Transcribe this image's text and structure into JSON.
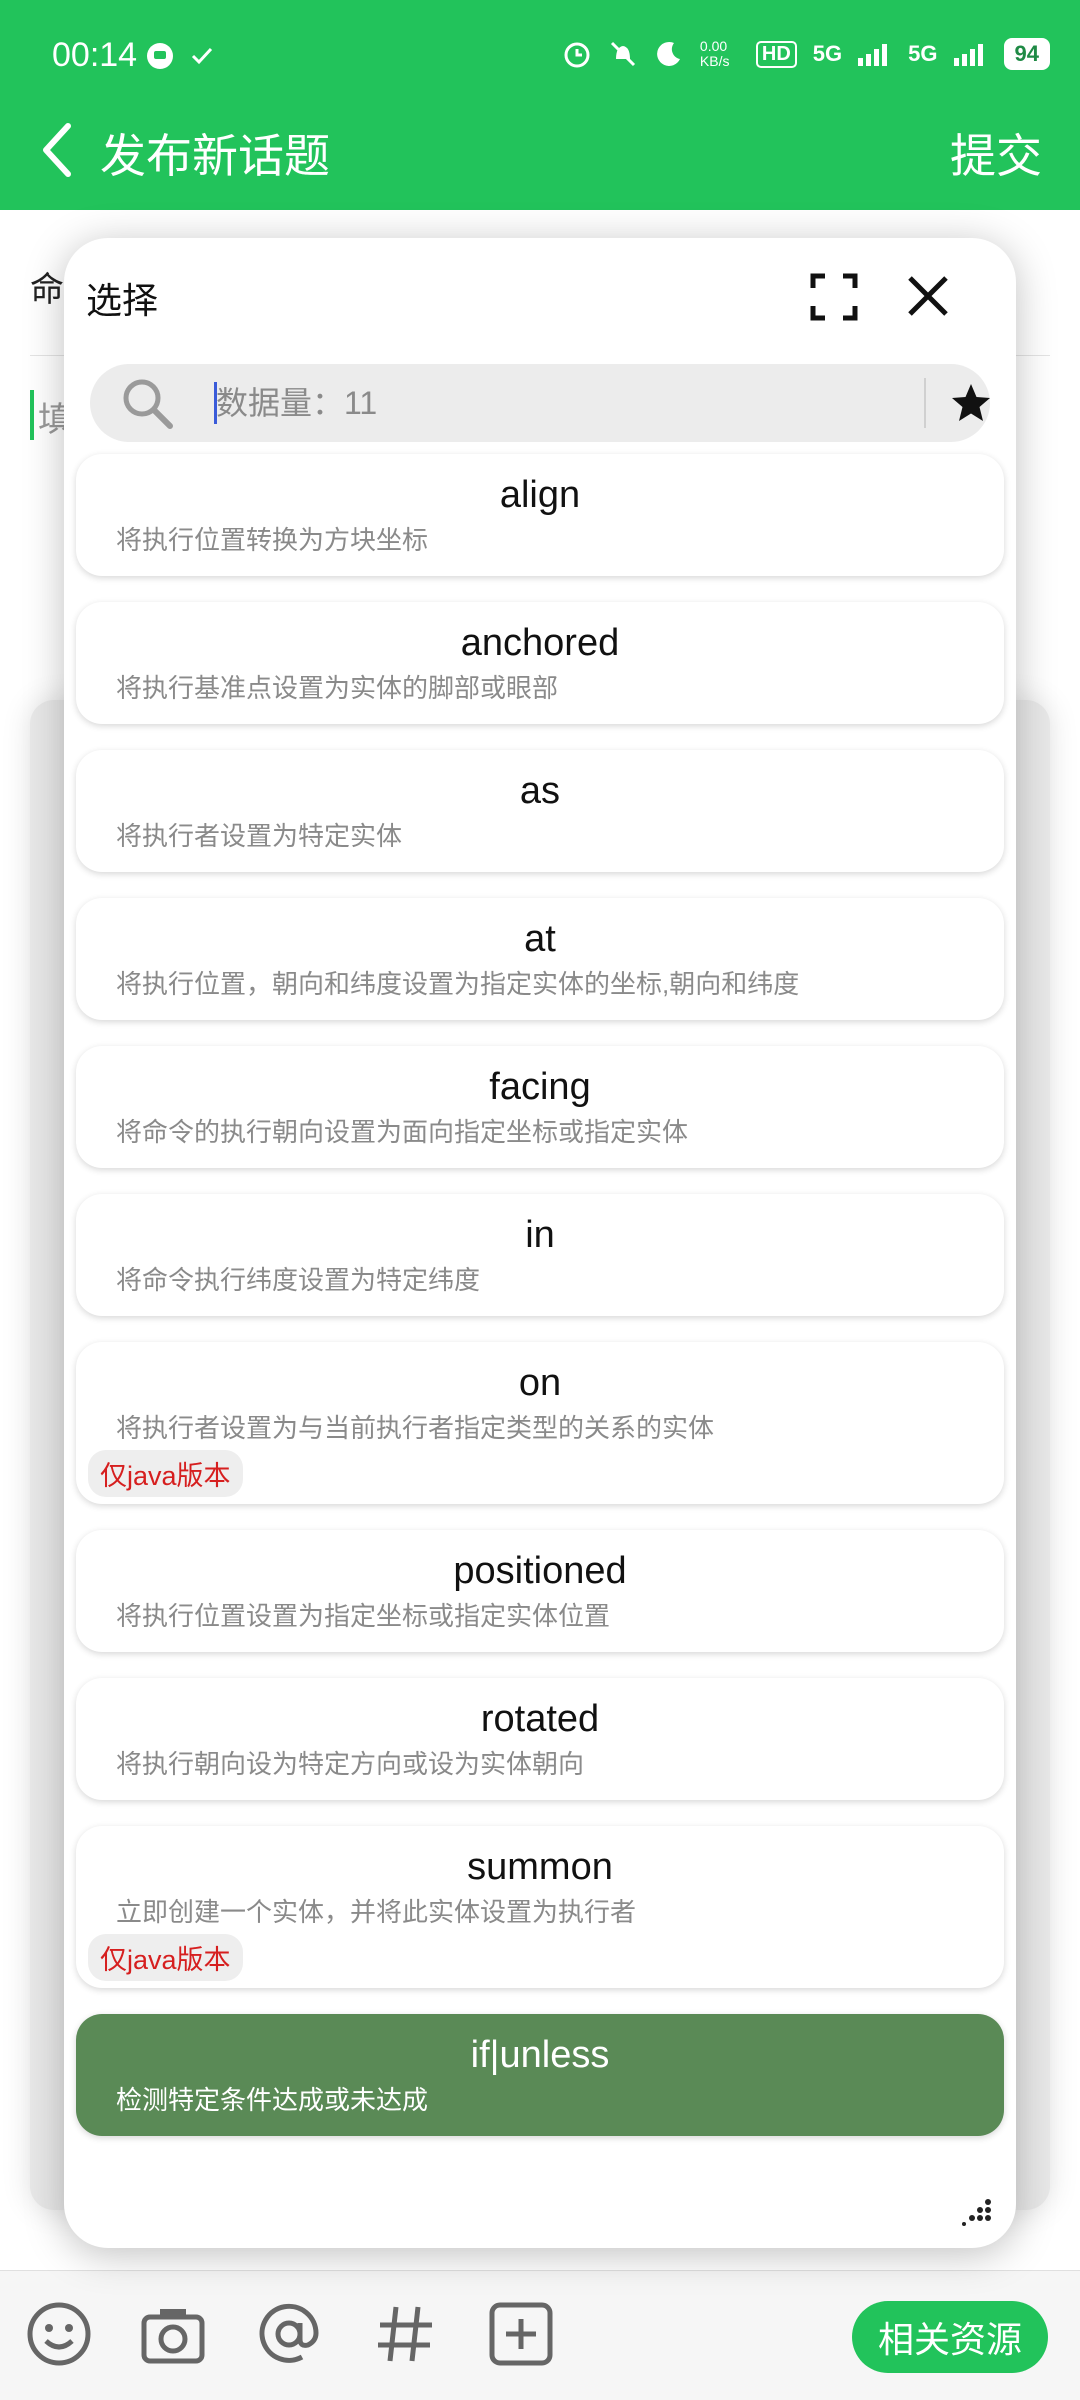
{
  "status_bar": {
    "time": "00:14",
    "net_speed": "0.00 KB/s",
    "hd": "HD",
    "signal_1": "5G",
    "signal_2": "5G",
    "battery": "94"
  },
  "header": {
    "title": "发布新话题",
    "submit_label": "提交"
  },
  "background_form": {
    "line1": "命",
    "line2": "填"
  },
  "dialog": {
    "title": "选择",
    "search_placeholder": "数据量：11",
    "items": [
      {
        "name": "align",
        "desc": "将执行位置转换为方块坐标",
        "badge": ""
      },
      {
        "name": "anchored",
        "desc": "将执行基准点设置为实体的脚部或眼部",
        "badge": ""
      },
      {
        "name": "as",
        "desc": "将执行者设置为特定实体",
        "badge": ""
      },
      {
        "name": "at",
        "desc": "将执行位置，朝向和纬度设置为指定实体的坐标,朝向和纬度",
        "badge": ""
      },
      {
        "name": "facing",
        "desc": "将命令的执行朝向设置为面向指定坐标或指定实体",
        "badge": ""
      },
      {
        "name": "in",
        "desc": "将命令执行纬度设置为特定纬度",
        "badge": ""
      },
      {
        "name": "on",
        "desc": "将执行者设置为与当前执行者指定类型的关系的实体",
        "badge": "仅java版本"
      },
      {
        "name": "positioned",
        "desc": "将执行位置设置为指定坐标或指定实体位置",
        "badge": ""
      },
      {
        "name": "rotated",
        "desc": "将执行朝向设为特定方向或设为实体朝向",
        "badge": ""
      },
      {
        "name": "summon",
        "desc": "立即创建一个实体，并将此实体设置为执行者",
        "badge": "仅java版本"
      },
      {
        "name": "if|unless",
        "desc": "检测特定条件达成或未达成",
        "badge": "",
        "selected": true
      }
    ]
  },
  "bottom_toolbar": {
    "icons": [
      "emoji-icon",
      "camera-icon",
      "mention-icon",
      "hashtag-icon",
      "add-box-icon"
    ],
    "resource_label": "相关资源"
  },
  "colors": {
    "brand_green": "#22c35b",
    "selected_item": "#5a8a56",
    "badge_red": "#d61f1f"
  }
}
